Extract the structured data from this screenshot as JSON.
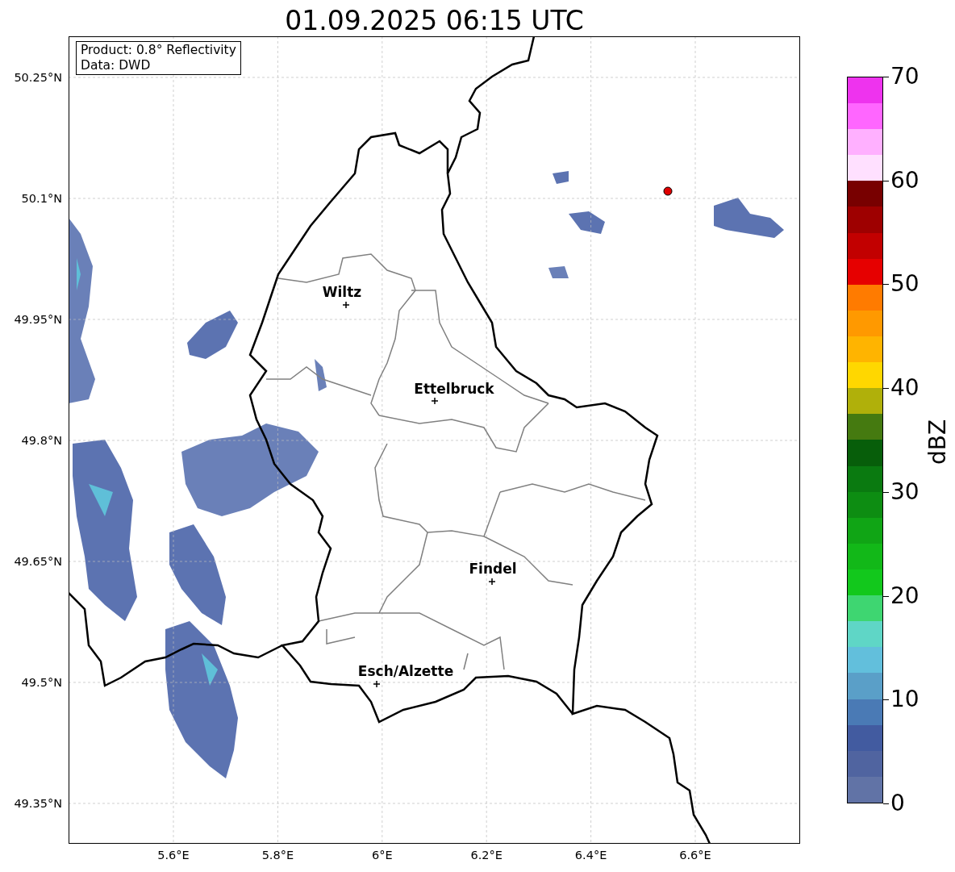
{
  "title": "01.09.2025 06:15 UTC",
  "info_box": [
    "Product: 0.8° Reflectivity",
    "Data: DWD"
  ],
  "y_tick_labels": [
    "50.25°N",
    "50.1°N",
    "49.95°N",
    "49.8°N",
    "49.65°N",
    "49.5°N",
    "49.35°N"
  ],
  "x_tick_labels": [
    "5.6°E",
    "5.8°E",
    "6°E",
    "6.2°E",
    "6.4°E",
    "6.6°E"
  ],
  "cities": [
    "Wiltz",
    "Ettelbruck",
    "Findel",
    "Esch/Alzette"
  ],
  "colorbar": {
    "label": "dBZ",
    "tick_labels": [
      "70",
      "60",
      "50",
      "40",
      "30",
      "20",
      "10",
      "0"
    ],
    "segments": [
      {
        "color": "#6173a6"
      },
      {
        "color": "#5064a0"
      },
      {
        "color": "#425ba0"
      },
      {
        "color": "#4a7ab5"
      },
      {
        "color": "#5a9fc8"
      },
      {
        "color": "#62bfdc"
      },
      {
        "color": "#5fd6c6"
      },
      {
        "color": "#3ed671"
      },
      {
        "color": "#12c81c"
      },
      {
        "color": "#12b818"
      },
      {
        "color": "#10a515"
      },
      {
        "color": "#0d8d12"
      },
      {
        "color": "#0a7a10"
      },
      {
        "color": "#075e0a"
      },
      {
        "color": "#457a10"
      },
      {
        "color": "#b0b00a"
      },
      {
        "color": "#ffd700"
      },
      {
        "color": "#ffb400"
      },
      {
        "color": "#ff9900"
      },
      {
        "color": "#ff7b00"
      },
      {
        "color": "#e60000"
      },
      {
        "color": "#c20000"
      },
      {
        "color": "#9e0000"
      },
      {
        "color": "#780000"
      },
      {
        "color": "#ffe0ff"
      },
      {
        "color": "#ffb0ff"
      },
      {
        "color": "#ff66ff"
      },
      {
        "color": "#ee33ee"
      }
    ]
  }
}
